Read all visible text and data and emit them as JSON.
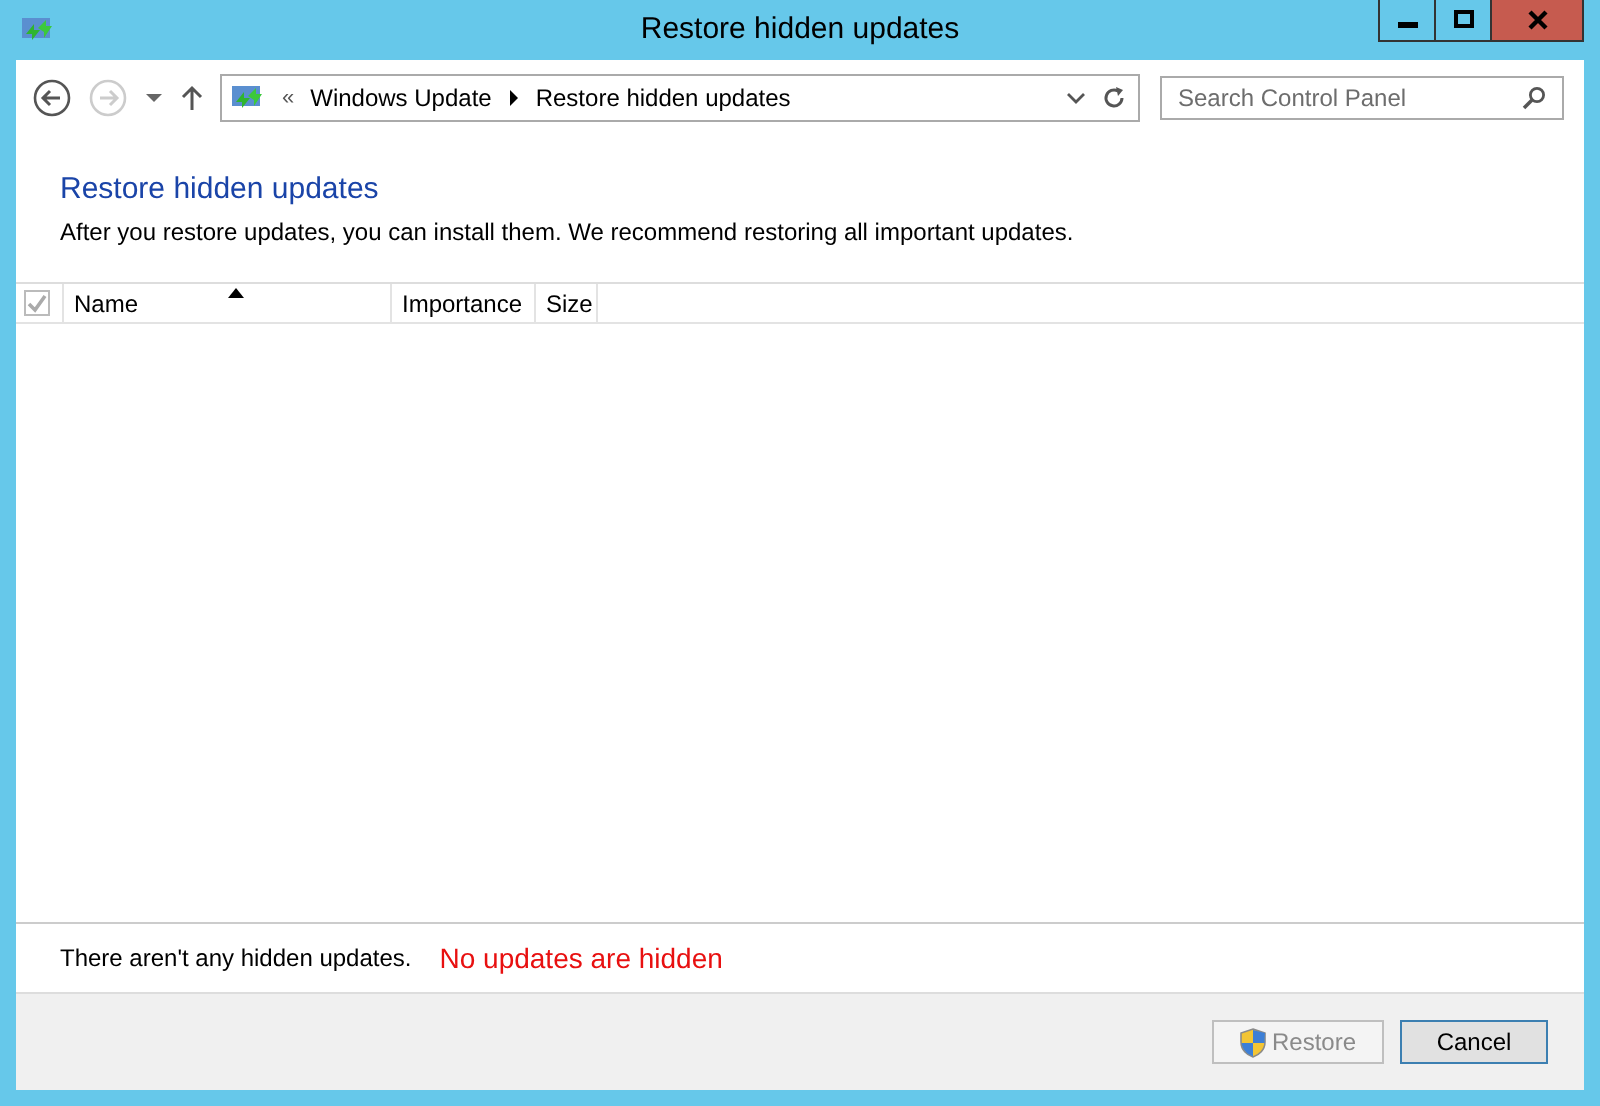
{
  "window": {
    "title": "Restore hidden updates"
  },
  "address": {
    "crumbs": [
      "Windows Update",
      "Restore hidden updates"
    ],
    "overflow": "«"
  },
  "search": {
    "placeholder": "Search Control Panel"
  },
  "heading": "Restore hidden updates",
  "description": "After you restore updates, you can install them. We recommend restoring all important updates.",
  "table": {
    "select_all": {
      "checked": true,
      "disabled": true
    },
    "columns": [
      {
        "label": "Name",
        "sorted": true
      },
      {
        "label": "Importance",
        "sorted": false
      },
      {
        "label": "Size",
        "sorted": false
      }
    ]
  },
  "status": "There aren't any hidden updates.",
  "annotation": "No updates are hidden",
  "buttons": [
    {
      "label": "Restore",
      "disabled": true,
      "shield": true
    },
    {
      "label": "Cancel",
      "disabled": false,
      "shield": false
    }
  ]
}
